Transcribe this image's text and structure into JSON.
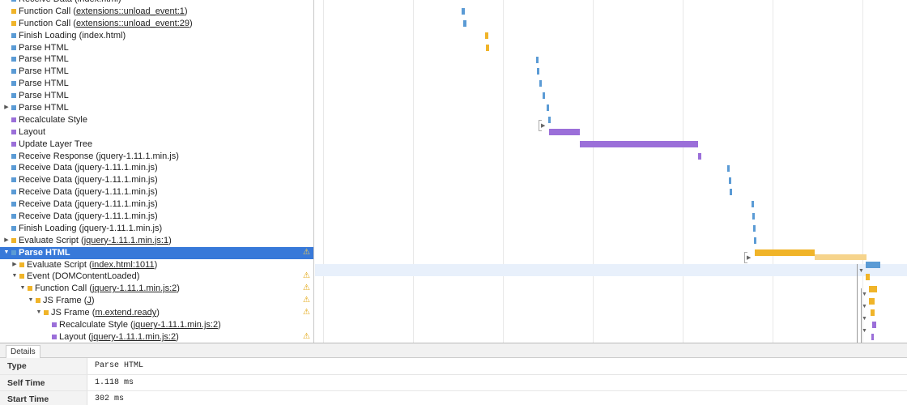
{
  "records": [
    {
      "indent": 0,
      "expand": "",
      "color": "#5b9bd5",
      "label": "Receive Data",
      "paren": "index.html",
      "linked": false,
      "warn": false,
      "selected": false
    },
    {
      "indent": 0,
      "expand": "",
      "color": "#f0b429",
      "label": "Function Call",
      "paren": "extensions::unload_event:1",
      "linked": true,
      "warn": false,
      "selected": false
    },
    {
      "indent": 0,
      "expand": "",
      "color": "#f0b429",
      "label": "Function Call",
      "paren": "extensions::unload_event:29",
      "linked": true,
      "warn": false,
      "selected": false
    },
    {
      "indent": 0,
      "expand": "",
      "color": "#5b9bd5",
      "label": "Finish Loading",
      "paren": "index.html",
      "linked": false,
      "warn": false,
      "selected": false
    },
    {
      "indent": 0,
      "expand": "",
      "color": "#5b9bd5",
      "label": "Parse HTML",
      "paren": "",
      "linked": false,
      "warn": false,
      "selected": false
    },
    {
      "indent": 0,
      "expand": "",
      "color": "#5b9bd5",
      "label": "Parse HTML",
      "paren": "",
      "linked": false,
      "warn": false,
      "selected": false
    },
    {
      "indent": 0,
      "expand": "",
      "color": "#5b9bd5",
      "label": "Parse HTML",
      "paren": "",
      "linked": false,
      "warn": false,
      "selected": false
    },
    {
      "indent": 0,
      "expand": "",
      "color": "#5b9bd5",
      "label": "Parse HTML",
      "paren": "",
      "linked": false,
      "warn": false,
      "selected": false
    },
    {
      "indent": 0,
      "expand": "",
      "color": "#5b9bd5",
      "label": "Parse HTML",
      "paren": "",
      "linked": false,
      "warn": false,
      "selected": false
    },
    {
      "indent": 0,
      "expand": "collapsed",
      "color": "#5b9bd5",
      "label": "Parse HTML",
      "paren": "",
      "linked": false,
      "warn": false,
      "selected": false
    },
    {
      "indent": 0,
      "expand": "",
      "color": "#9b6fd9",
      "label": "Recalculate Style",
      "paren": "",
      "linked": false,
      "warn": false,
      "selected": false
    },
    {
      "indent": 0,
      "expand": "",
      "color": "#9b6fd9",
      "label": "Layout",
      "paren": "",
      "linked": false,
      "warn": false,
      "selected": false
    },
    {
      "indent": 0,
      "expand": "",
      "color": "#9b6fd9",
      "label": "Update Layer Tree",
      "paren": "",
      "linked": false,
      "warn": false,
      "selected": false
    },
    {
      "indent": 0,
      "expand": "",
      "color": "#5b9bd5",
      "label": "Receive Response",
      "paren": "jquery-1.11.1.min.js",
      "linked": false,
      "warn": false,
      "selected": false
    },
    {
      "indent": 0,
      "expand": "",
      "color": "#5b9bd5",
      "label": "Receive Data",
      "paren": "jquery-1.11.1.min.js",
      "linked": false,
      "warn": false,
      "selected": false
    },
    {
      "indent": 0,
      "expand": "",
      "color": "#5b9bd5",
      "label": "Receive Data",
      "paren": "jquery-1.11.1.min.js",
      "linked": false,
      "warn": false,
      "selected": false
    },
    {
      "indent": 0,
      "expand": "",
      "color": "#5b9bd5",
      "label": "Receive Data",
      "paren": "jquery-1.11.1.min.js",
      "linked": false,
      "warn": false,
      "selected": false
    },
    {
      "indent": 0,
      "expand": "",
      "color": "#5b9bd5",
      "label": "Receive Data",
      "paren": "jquery-1.11.1.min.js",
      "linked": false,
      "warn": false,
      "selected": false
    },
    {
      "indent": 0,
      "expand": "",
      "color": "#5b9bd5",
      "label": "Receive Data",
      "paren": "jquery-1.11.1.min.js",
      "linked": false,
      "warn": false,
      "selected": false
    },
    {
      "indent": 0,
      "expand": "",
      "color": "#5b9bd5",
      "label": "Finish Loading",
      "paren": "jquery-1.11.1.min.js",
      "linked": false,
      "warn": false,
      "selected": false
    },
    {
      "indent": 0,
      "expand": "collapsed",
      "color": "#f0b429",
      "label": "Evaluate Script",
      "paren": "jquery-1.11.1.min.js:1",
      "linked": true,
      "warn": false,
      "selected": false
    },
    {
      "indent": 0,
      "expand": "expanded",
      "color": "#5b9bd5",
      "label": "Parse HTML",
      "paren": "",
      "linked": false,
      "warn": true,
      "selected": true
    },
    {
      "indent": 1,
      "expand": "collapsed",
      "color": "#f0b429",
      "label": "Evaluate Script",
      "paren": "index.html:1011",
      "linked": true,
      "warn": false,
      "selected": false
    },
    {
      "indent": 1,
      "expand": "expanded",
      "color": "#f0b429",
      "label": "Event",
      "paren": "DOMContentLoaded",
      "linked": false,
      "warn": true,
      "selected": false
    },
    {
      "indent": 2,
      "expand": "expanded",
      "color": "#f0b429",
      "label": "Function Call",
      "paren": "jquery-1.11.1.min.js:2",
      "linked": true,
      "warn": true,
      "selected": false
    },
    {
      "indent": 3,
      "expand": "expanded",
      "color": "#f0b429",
      "label": "JS Frame",
      "paren": "J",
      "linked": true,
      "warn": true,
      "selected": false
    },
    {
      "indent": 4,
      "expand": "expanded",
      "color": "#f0b429",
      "label": "JS Frame",
      "paren": "m.extend.ready",
      "linked": true,
      "warn": true,
      "selected": false
    },
    {
      "indent": 5,
      "expand": "",
      "color": "#9b6fd9",
      "label": "Recalculate Style",
      "paren": "jquery-1.11.1.min.js:2",
      "linked": true,
      "warn": false,
      "selected": false
    },
    {
      "indent": 5,
      "expand": "",
      "color": "#9b6fd9",
      "label": "Layout",
      "paren": "jquery-1.11.1.min.js:2",
      "linked": true,
      "warn": true,
      "selected": false
    }
  ],
  "timeline_bars": [
    {
      "row": 1,
      "start": 181,
      "dur": 4,
      "color": "#5b9bd5"
    },
    {
      "row": 2,
      "start": 183,
      "dur": 4,
      "color": "#5b9bd5"
    },
    {
      "row": 3,
      "start": 210,
      "dur": 4,
      "color": "#f0b429"
    },
    {
      "row": 4,
      "start": 211,
      "dur": 4,
      "color": "#f0b429"
    },
    {
      "row": 5,
      "start": 273,
      "dur": 3,
      "color": "#5b9bd5"
    },
    {
      "row": 6,
      "start": 274,
      "dur": 3,
      "color": "#5b9bd5"
    },
    {
      "row": 7,
      "start": 277,
      "dur": 3,
      "color": "#5b9bd5"
    },
    {
      "row": 8,
      "start": 281,
      "dur": 3,
      "color": "#5b9bd5"
    },
    {
      "row": 9,
      "start": 286,
      "dur": 3,
      "color": "#5b9bd5"
    },
    {
      "row": 10,
      "start": 288,
      "dur": 3,
      "color": "#5b9bd5"
    },
    {
      "row": 11,
      "start": 289,
      "dur": 38,
      "color": "#9b6fd9"
    },
    {
      "row": 12,
      "start": 327,
      "dur": 146,
      "color": "#9b6fd9"
    },
    {
      "row": 13,
      "start": 473,
      "dur": 4,
      "color": "#9b6fd9"
    },
    {
      "row": 14,
      "start": 509,
      "dur": 3,
      "color": "#5b9bd5"
    },
    {
      "row": 15,
      "start": 511,
      "dur": 3,
      "color": "#5b9bd5"
    },
    {
      "row": 16,
      "start": 512,
      "dur": 3,
      "color": "#5b9bd5"
    },
    {
      "row": 17,
      "start": 539,
      "dur": 3,
      "color": "#5b9bd5"
    },
    {
      "row": 18,
      "start": 540,
      "dur": 3,
      "color": "#5b9bd5"
    },
    {
      "row": 19,
      "start": 541,
      "dur": 3,
      "color": "#5b9bd5"
    },
    {
      "row": 20,
      "start": 542,
      "dur": 3,
      "color": "#5b9bd5"
    },
    {
      "row": 21,
      "start": 543,
      "dur": 74,
      "color": "#f0b429"
    },
    {
      "row": 22,
      "start": 680,
      "dur": 18,
      "color": "#5b9bd5"
    },
    {
      "row": 23,
      "start": 680,
      "dur": 5,
      "color": "#f0b429"
    },
    {
      "row": 24,
      "start": 684,
      "dur": 10,
      "color": "#f0b429"
    },
    {
      "row": 25,
      "start": 684,
      "dur": 7,
      "color": "#f0b429"
    },
    {
      "row": 26,
      "start": 686,
      "dur": 5,
      "color": "#f0b429"
    },
    {
      "row": 27,
      "start": 688,
      "dur": 5,
      "color": "#9b6fd9"
    },
    {
      "row": 28,
      "start": 687,
      "dur": 3,
      "color": "#9b6fd9"
    }
  ],
  "details": {
    "tab_label": "Details",
    "rows": [
      {
        "key": "Type",
        "value": "Parse HTML"
      },
      {
        "key": "Self Time",
        "value": "1.118 ms"
      },
      {
        "key": "Start Time",
        "value": "302 ms"
      }
    ]
  }
}
